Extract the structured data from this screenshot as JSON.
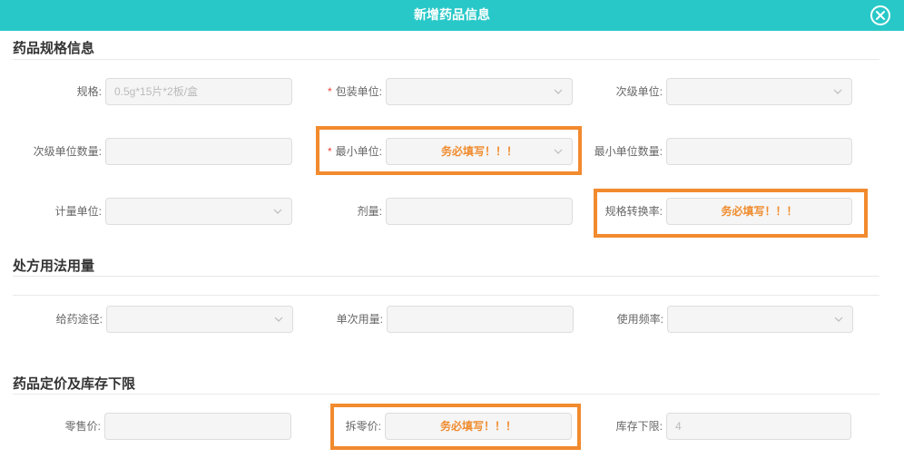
{
  "dialog": {
    "title": "新增药品信息",
    "close_icon": "close-circle-icon"
  },
  "sections": {
    "spec": "药品规格信息",
    "usage": "处方用法用量",
    "price": "药品定价及库存下限"
  },
  "required_marker": "*",
  "fields": {
    "spec": {
      "label": "规格:",
      "placeholder": "0.5g*15片*2板/盒"
    },
    "package_unit": {
      "label": "包装单位:"
    },
    "secondary_unit": {
      "label": "次级单位:"
    },
    "secondary_unit_qty": {
      "label": "次级单位数量:"
    },
    "min_unit": {
      "label": "最小单位:",
      "hint": "务必填写！！！"
    },
    "min_unit_qty": {
      "label": "最小单位数量:"
    },
    "measure_unit": {
      "label": "计量单位:"
    },
    "dosage": {
      "label": "剂量:"
    },
    "conversion_rate": {
      "label": "规格转换率:",
      "hint": "务必填写！！！"
    },
    "route": {
      "label": "给药途径:"
    },
    "single_dose": {
      "label": "单次用量:"
    },
    "frequency": {
      "label": "使用频率:"
    },
    "retail_price": {
      "label": "零售价:"
    },
    "split_price": {
      "label": "拆零价:",
      "hint": "务必填写！！！"
    },
    "stock_floor": {
      "label": "库存下限:",
      "placeholder": "4"
    }
  },
  "colors": {
    "header": "#29c8c8",
    "highlight": "#f28a2e",
    "hint": "#f08c2e",
    "required": "#e9443a"
  }
}
